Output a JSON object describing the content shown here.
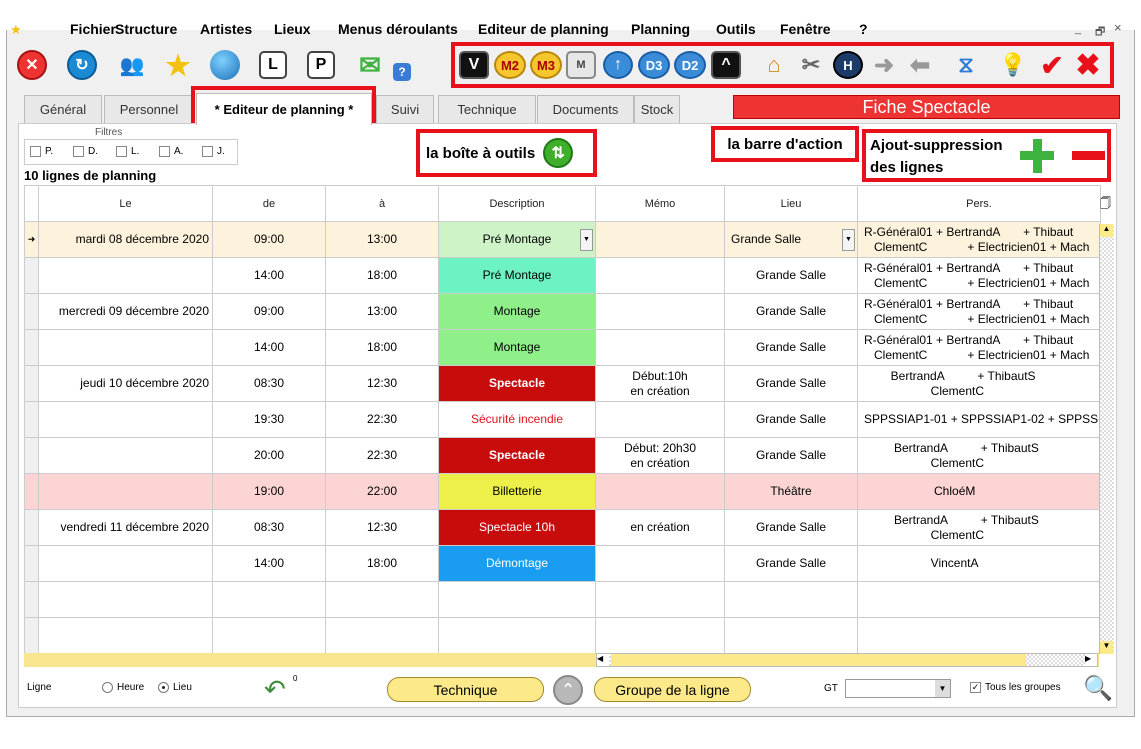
{
  "menu": {
    "items": [
      "Fichier",
      "Structure",
      "Artistes",
      "Lieux",
      "Menus déroulants",
      "Editeur de planning",
      "Planning",
      "Outils",
      "Fenêtre",
      "?"
    ],
    "window_controls": [
      "_",
      "🗗",
      "×"
    ]
  },
  "toolbar": {
    "buttons_left": [
      {
        "name": "close",
        "icon": "close-red-circle-icon",
        "color": "#e33"
      },
      {
        "name": "refresh",
        "icon": "refresh-blue-circle-icon",
        "color": "#1a8ad4"
      },
      {
        "name": "users",
        "icon": "users-icon"
      },
      {
        "name": "star",
        "icon": "star-icon",
        "color": "#f4c20d"
      },
      {
        "name": "globe",
        "icon": "globe-icon"
      },
      {
        "name": "l-doc",
        "icon": "l-document-icon",
        "label": "L"
      },
      {
        "name": "p-doc",
        "icon": "p-document-icon",
        "label": "P"
      },
      {
        "name": "envelope",
        "icon": "envelope-green-icon"
      },
      {
        "name": "settings-help",
        "icon": "gear-help-icon",
        "label": "?"
      }
    ],
    "action_buttons": [
      {
        "name": "v",
        "icon": "v-black-icon",
        "label": "V"
      },
      {
        "name": "m2",
        "icon": "m2-yellow-icon",
        "label": "M2"
      },
      {
        "name": "m3",
        "icon": "m3-yellow-icon",
        "label": "M3"
      },
      {
        "name": "m",
        "icon": "m-gray-icon",
        "label": "M"
      },
      {
        "name": "up",
        "icon": "up-arrow-circle-icon",
        "label": "↑"
      },
      {
        "name": "d3",
        "icon": "d3-blue-icon",
        "label": "D3"
      },
      {
        "name": "d2",
        "icon": "d2-blue-icon",
        "label": "D2"
      },
      {
        "name": "caret",
        "icon": "caret-up-black-icon",
        "label": "^"
      },
      {
        "name": "house-tools",
        "icon": "house-tools-icon"
      },
      {
        "name": "tools",
        "icon": "wrench-screwdriver-icon"
      },
      {
        "name": "h",
        "icon": "h-hexagon-icon",
        "label": "H"
      },
      {
        "name": "arrow-right",
        "icon": "arrow-right-gray-icon"
      },
      {
        "name": "arrow-left",
        "icon": "arrow-left-gray-icon"
      },
      {
        "name": "chart",
        "icon": "chart-check-icon"
      },
      {
        "name": "bulb",
        "icon": "lightbulb-icon"
      },
      {
        "name": "validate",
        "icon": "check-red-icon",
        "label": "✔"
      },
      {
        "name": "cancel",
        "icon": "x-red-icon",
        "label": "✖"
      }
    ]
  },
  "tabs": [
    {
      "label": "Général",
      "active": false
    },
    {
      "label": "Personnel",
      "active": false
    },
    {
      "label": "* Editeur de planning *",
      "active": true
    },
    {
      "label": "Suivi",
      "active": false
    },
    {
      "label": "Technique",
      "active": false
    },
    {
      "label": "Documents",
      "active": false
    },
    {
      "label": "Stock",
      "active": false
    }
  ],
  "fiche_title": "Fiche Spectacle",
  "filters": {
    "label": "Filtres",
    "items": [
      "P.",
      "D.",
      "L.",
      "A.",
      "J."
    ]
  },
  "line_count": "10 lignes de planning",
  "callouts": {
    "toolbox": "la boîte à outils",
    "action_bar": "la barre d'action",
    "add_remove_line1": "Ajout-suppression",
    "add_remove_line2": "des lignes"
  },
  "columns": [
    "Le",
    "de",
    "à",
    "Description",
    "Mémo",
    "Lieu",
    "Pers."
  ],
  "rows": [
    {
      "le": "mardi 08 décembre 2020",
      "de": "09:00",
      "a": "13:00",
      "desc": "Pré Montage",
      "desc_bg": "#cdf3c7",
      "desc_fg": "#000",
      "memo": "",
      "lieu": "Grande Salle",
      "pers": "R-Général01 + BertrandA       + Thibaut\n   ClementC            + Electricien01 + Mach",
      "style": "sel",
      "dropdown": true
    },
    {
      "le": "",
      "de": "14:00",
      "a": "18:00",
      "desc": "Pré Montage",
      "desc_bg": "#6df2c4",
      "desc_fg": "#000",
      "memo": "",
      "lieu": "Grande Salle",
      "pers": "R-Général01 + BertrandA       + Thibaut\n   ClementC            + Electricien01 + Mach",
      "style": ""
    },
    {
      "le": "mercredi 09 décembre 2020",
      "de": "09:00",
      "a": "13:00",
      "desc": "Montage",
      "desc_bg": "#8ff08a",
      "desc_fg": "#000",
      "memo": "",
      "lieu": "Grande Salle",
      "pers": "R-Général01 + BertrandA       + Thibaut\n   ClementC            + Electricien01 + Mach",
      "style": ""
    },
    {
      "le": "",
      "de": "14:00",
      "a": "18:00",
      "desc": "Montage",
      "desc_bg": "#8ff08a",
      "desc_fg": "#000",
      "memo": "",
      "lieu": "Grande Salle",
      "pers": "R-Général01 + BertrandA       + Thibaut\n   ClementC            + Electricien01 + Mach",
      "style": ""
    },
    {
      "le": "jeudi 10 décembre 2020",
      "de": "08:30",
      "a": "12:30",
      "desc": "Spectacle",
      "desc_bg": "#c80c0c",
      "desc_fg": "#fff",
      "desc_bold": true,
      "memo": "Début:10h\nen création",
      "lieu": "Grande Salle",
      "pers": "        BertrandA          + ThibautS\n                    ClementC",
      "style": ""
    },
    {
      "le": "",
      "de": "19:30",
      "a": "22:30",
      "desc": "Sécurité incendie",
      "desc_bg": "#fff",
      "desc_fg": "#e0131b",
      "memo": "",
      "lieu": "Grande Salle",
      "pers": "SPPSSIAP1-01 + SPPSSIAP1-02 + SPPSS",
      "style": ""
    },
    {
      "le": "",
      "de": "20:00",
      "a": "22:30",
      "desc": "Spectacle",
      "desc_bg": "#c80c0c",
      "desc_fg": "#fff",
      "desc_bold": true,
      "memo": "Début: 20h30\nen création",
      "lieu": "Grande Salle",
      "pers": "         BertrandA          + ThibautS\n                    ClementC",
      "style": ""
    },
    {
      "le": "",
      "de": "19:00",
      "a": "22:00",
      "desc": "Billetterie",
      "desc_bg": "#eef04a",
      "desc_fg": "#000",
      "memo": "",
      "lieu": "Théâtre",
      "pers": "                     ChloéM",
      "style": "pink"
    },
    {
      "le": "vendredi 11 décembre 2020",
      "de": "08:30",
      "a": "12:30",
      "desc": "Spectacle 10h",
      "desc_bg": "#c80c0c",
      "desc_fg": "#fff",
      "memo": "en création",
      "lieu": "Grande Salle",
      "pers": "         BertrandA          + ThibautS\n                    ClementC",
      "style": ""
    },
    {
      "le": "",
      "de": "14:00",
      "a": "18:00",
      "desc": "Démontage",
      "desc_bg": "#1a9df0",
      "desc_fg": "#fff",
      "memo": "",
      "lieu": "Grande Salle",
      "pers": "                    VincentA",
      "style": ""
    },
    {
      "le": "",
      "de": "",
      "a": "",
      "desc": "",
      "desc_bg": "#fff",
      "desc_fg": "#000",
      "memo": "",
      "lieu": "",
      "pers": "",
      "style": ""
    },
    {
      "le": "",
      "de": "",
      "a": "",
      "desc": "",
      "desc_bg": "#fff",
      "desc_fg": "#000",
      "memo": "",
      "lieu": "",
      "pers": "",
      "style": ""
    }
  ],
  "bottom": {
    "ligne_label": "Ligne",
    "radio_heure": "Heure",
    "radio_lieu": "Lieu",
    "undo_count": "0",
    "technique_btn": "Technique",
    "groupe_btn": "Groupe de la ligne",
    "gt_label": "GT",
    "tous_groupes": "Tous les groupes"
  }
}
